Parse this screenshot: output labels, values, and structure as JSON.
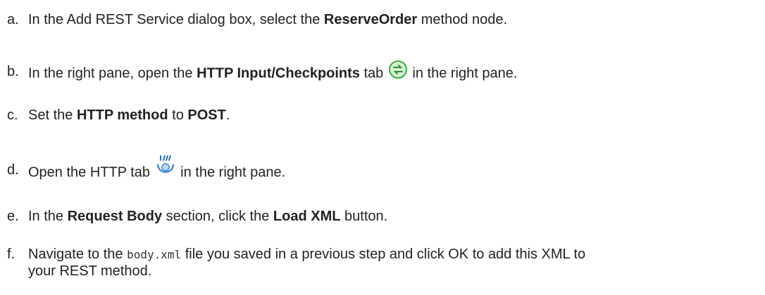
{
  "steps": [
    {
      "letter": "a.",
      "t1": "In the Add REST Service dialog box, select the ",
      "b1": "ReserveOrder",
      "t2": " method node."
    },
    {
      "letter": "b.",
      "t1": "In the right pane, open the ",
      "b1": "HTTP Input/Checkpoints",
      "t2": " tab ",
      "t3": " in the right pane.",
      "icon": "http-input-checkpoints-tab-icon"
    },
    {
      "letter": "c.",
      "t1": "Set the ",
      "b1": "HTTP method",
      "t2": " to ",
      "b2": "POST",
      "t3": "."
    },
    {
      "letter": "d.",
      "t1": "Open the HTTP tab ",
      "t2": " in the right pane.",
      "icon": "http-tab-icon"
    },
    {
      "letter": "e.",
      "t1": "In the ",
      "b1": "Request Body",
      "t2": " section, click the ",
      "b2": "Load XML",
      "t3": " button."
    },
    {
      "letter": "f.",
      "t1": "Navigate to the ",
      "code": "body.xml",
      "t2": " file you saved in a previous step and click OK to add this XML to",
      "t3": "your REST method."
    }
  ],
  "colors": {
    "text": "#222222",
    "icon_green": "#3cae3c",
    "icon_blue": "#4a8bd0"
  }
}
